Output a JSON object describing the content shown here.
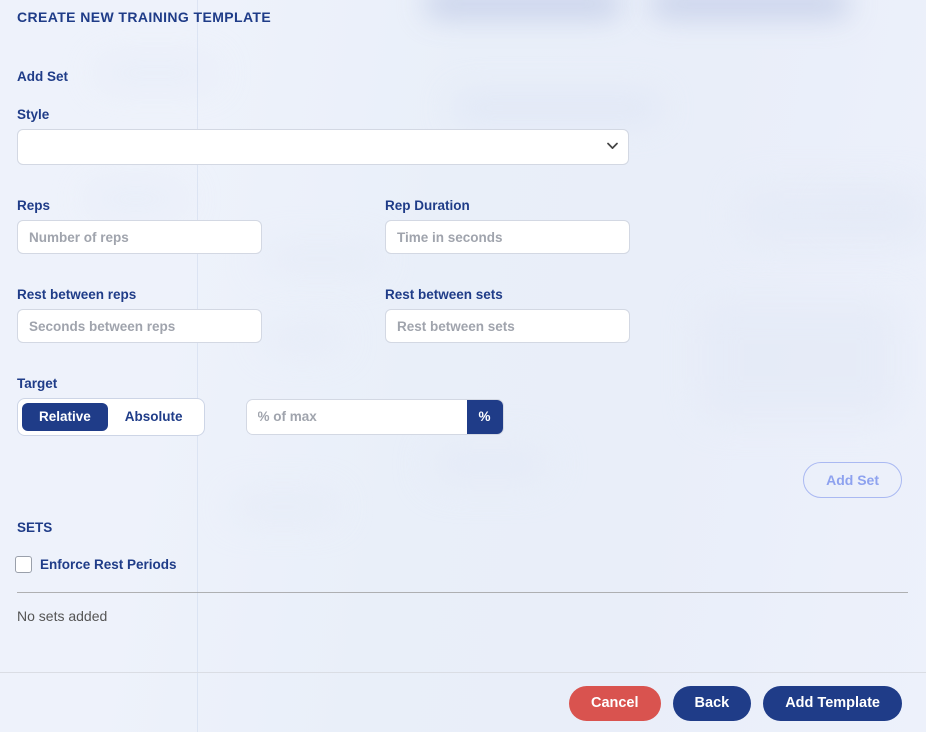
{
  "header": {
    "title": "CREATE NEW TRAINING TEMPLATE"
  },
  "add_set_section": {
    "heading": "Add Set",
    "style": {
      "label": "Style",
      "value": "",
      "options": []
    },
    "reps": {
      "label": "Reps",
      "placeholder": "Number of reps",
      "value": ""
    },
    "rep_duration": {
      "label": "Rep Duration",
      "placeholder": "Time in seconds",
      "value": ""
    },
    "rest_between_reps": {
      "label": "Rest between reps",
      "placeholder": "Seconds between reps",
      "value": ""
    },
    "rest_between_sets": {
      "label": "Rest between sets",
      "placeholder": "Rest between sets",
      "value": ""
    },
    "target": {
      "label": "Target",
      "relative_label": "Relative",
      "absolute_label": "Absolute",
      "selected": "Relative",
      "percent_placeholder": "% of max",
      "percent_value": "",
      "percent_addon": "%"
    },
    "add_set_button": "Add Set"
  },
  "sets_section": {
    "heading": "SETS",
    "enforce_rest_label": "Enforce Rest Periods",
    "enforce_rest_checked": false,
    "empty_message": "No sets added"
  },
  "footer": {
    "cancel": "Cancel",
    "back": "Back",
    "submit": "Add Template"
  },
  "colors": {
    "navy": "#1f3c88",
    "danger": "#d9534f",
    "outline_accent": "#8ea2ef",
    "page_bg": "#eef2fb"
  },
  "icons": {
    "select_chevron": "chevron-down-icon"
  }
}
